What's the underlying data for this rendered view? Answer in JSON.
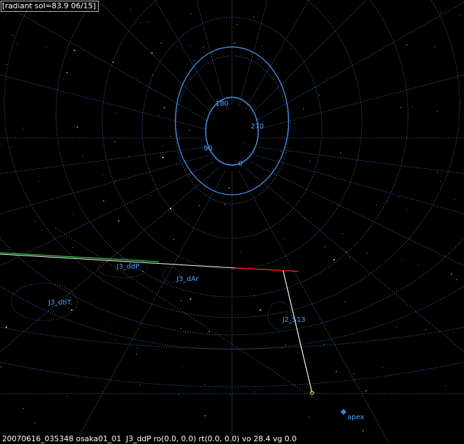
{
  "window": {
    "title": "[radiant sol=83.9 06/15]"
  },
  "status_bar": {
    "text": "20070616_035348 osaka01_01  J3_ddP ro(0.0, 0.0) rt(0.0, 0.0) vo 28.4 vg 0.0"
  },
  "polar_ring_labels": {
    "north": "180",
    "east": "270",
    "west": "90",
    "south": "0"
  },
  "radiant_labels": {
    "j3_ddp": "J3_ddP",
    "j3_dar": "J3_dAr",
    "j3_dbt": "J3_dbT.",
    "j2_s13": "J2_S13",
    "apex": "apex"
  },
  "colors": {
    "background": "#000000",
    "grid": "#3f6fae",
    "label": "#4aa3ff",
    "trail_green": "#36c83c",
    "trail_white": "#ffffff",
    "trail_red": "#e01818",
    "apex_marker": "#2f86ff",
    "orbit_dotted": "#b06a3a",
    "star": "#c8c8c8"
  }
}
